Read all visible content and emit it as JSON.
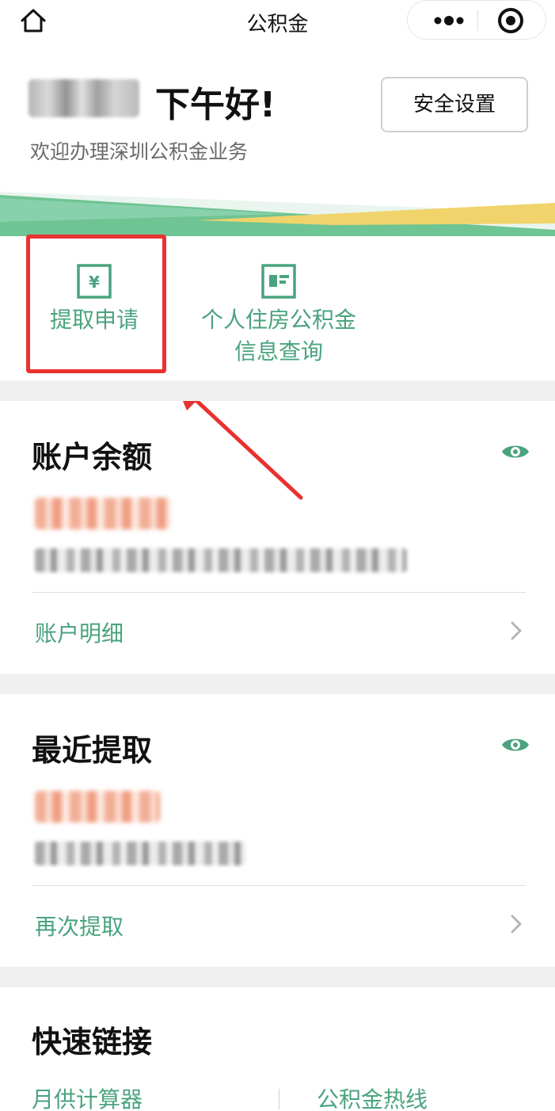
{
  "nav": {
    "title": "公积金",
    "home_icon": "home-icon",
    "more_icon": "more-dots-icon",
    "close_icon": "miniapp-close-icon"
  },
  "greeting": {
    "name": "(blurred)",
    "hello": "下午好!",
    "welcome": "欢迎办理深圳公积金业务",
    "security_button": "安全设置"
  },
  "services": [
    {
      "label": "提取申请",
      "icon": "yuan-withdraw-icon"
    },
    {
      "label": "个人住房公积金\n信息查询",
      "icon": "info-card-icon"
    }
  ],
  "balance_card": {
    "title": "账户余额",
    "amount": "(blurred)",
    "updated": "(blurred)",
    "link": "账户明细"
  },
  "withdraw_card": {
    "title": "最近提取",
    "amount": "(blurred)",
    "date": "(blurred)",
    "link": "再次提取"
  },
  "quick_links": {
    "title": "快速链接",
    "items": [
      "月供计算器",
      "公积金热线"
    ]
  },
  "colors": {
    "accent": "#4aa37f",
    "highlight": "#e8322f",
    "band_green": "#6fc493",
    "band_yellow": "#f1d36b"
  }
}
